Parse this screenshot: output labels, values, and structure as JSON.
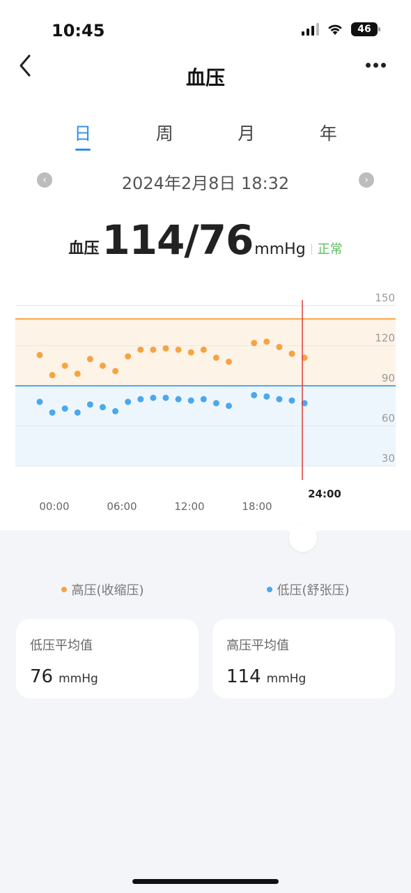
{
  "status_bar": {
    "time": "10:45",
    "battery": "46"
  },
  "nav": {
    "title": "血压"
  },
  "tabs": [
    {
      "label": "日",
      "active": true
    },
    {
      "label": "周",
      "active": false
    },
    {
      "label": "月",
      "active": false
    },
    {
      "label": "年",
      "active": false
    }
  ],
  "date": {
    "text": "2024年2月8日   18:32"
  },
  "reading": {
    "label": "血压",
    "value": "114/76",
    "unit": "mmHg",
    "status": "正常"
  },
  "colors": {
    "systolic": "#f5a442",
    "diastolic": "#4aa8ee",
    "marker": "#e03a3a",
    "normal_status": "#5bbb5b",
    "accent": "#2f8ee8"
  },
  "chart_data": {
    "type": "scatter",
    "y_ticks": [
      "150",
      "120",
      "90",
      "60",
      "30"
    ],
    "ylim": [
      30,
      150
    ],
    "x_labels": [
      "00:00",
      "06:00",
      "12:00",
      "18:00"
    ],
    "marker_label": "24:00",
    "bands": {
      "systolic_threshold": 140,
      "diastolic_threshold": 90
    },
    "series": [
      {
        "name": "高压(收缩压)",
        "color": "#f5a442",
        "values": [
          113,
          98,
          105,
          99,
          110,
          105,
          101,
          112,
          117,
          117,
          118,
          117,
          115,
          117,
          111,
          108,
          null,
          122,
          123,
          119,
          114,
          111
        ]
      },
      {
        "name": "低压(舒张压)",
        "color": "#4aa8ee",
        "values": [
          78,
          70,
          73,
          70,
          76,
          74,
          71,
          78,
          80,
          81,
          81,
          80,
          79,
          80,
          77,
          75,
          null,
          83,
          82,
          80,
          79,
          77
        ]
      }
    ]
  },
  "legend": {
    "systolic": "高压(收缩压)",
    "diastolic": "低压(舒张压)"
  },
  "cards": {
    "left": {
      "title": "低压平均值",
      "value": "76",
      "unit": "mmHg"
    },
    "right": {
      "title": "高压平均值",
      "value": "114",
      "unit": "mmHg"
    }
  }
}
